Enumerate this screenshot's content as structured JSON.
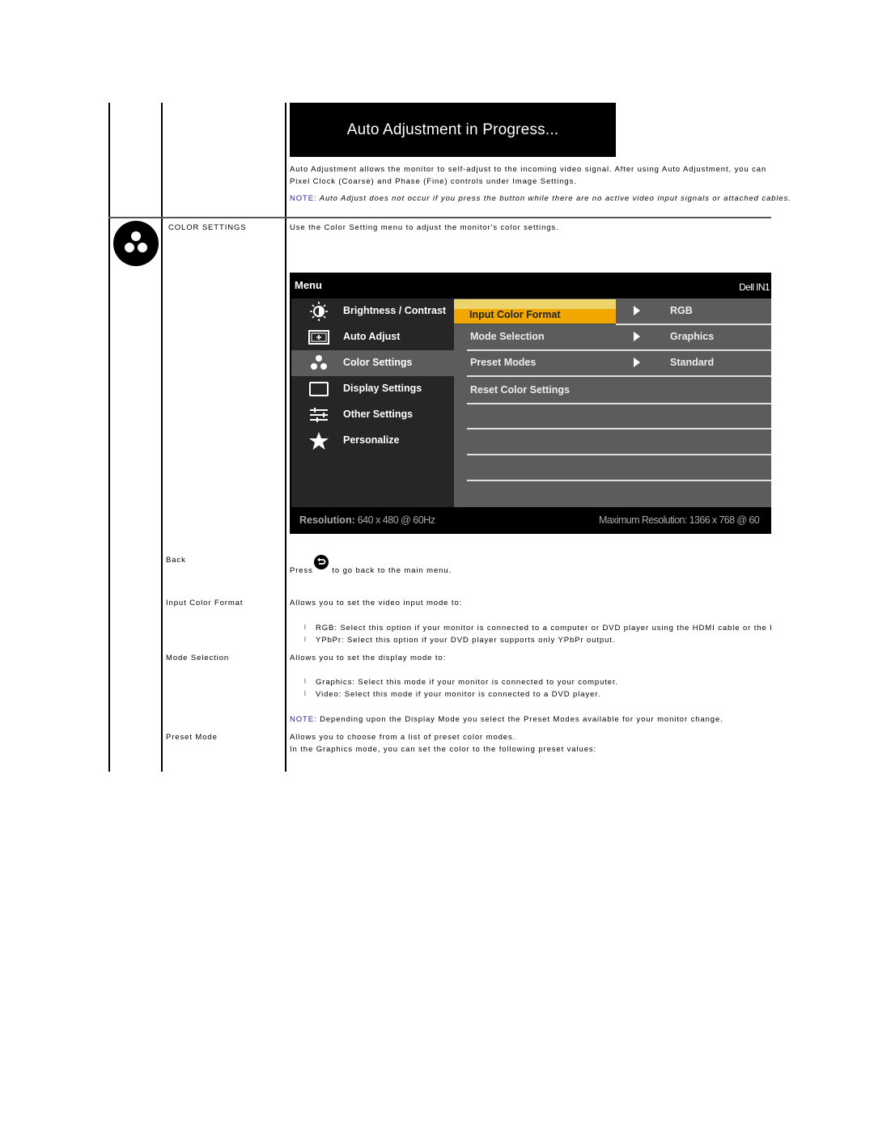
{
  "auto_adjust": {
    "banner_title": "Auto Adjustment in Progress...",
    "description_line1": "Auto Adjustment allows the monitor to self-adjust to the incoming video signal. After using Auto Adjustment, you can",
    "description_line2": "Pixel Clock (Coarse) and Phase (Fine) controls under Image Settings.",
    "note_label": "NOTE:",
    "note_text": " Auto Adjust does not occur if you press the button while there are no active video input signals or attached cables."
  },
  "color_settings": {
    "icon": "color-settings-icon",
    "label": "COLOR SETTINGS",
    "description": "Use the Color Setting menu to adjust the monitor's color settings."
  },
  "osd": {
    "menu_title": "Menu",
    "brand": "Dell IN1",
    "main_items": [
      {
        "icon": "brightness-contrast-icon",
        "label": "Brightness / Contrast",
        "active": false
      },
      {
        "icon": "auto-adjust-icon",
        "label": "Auto Adjust",
        "active": false
      },
      {
        "icon": "color-settings-icon",
        "label": "Color Settings",
        "active": true
      },
      {
        "icon": "display-settings-icon",
        "label": "Display Settings",
        "active": false
      },
      {
        "icon": "other-settings-icon",
        "label": "Other Settings",
        "active": false
      },
      {
        "icon": "personalize-icon",
        "label": "Personalize",
        "active": false
      }
    ],
    "sub_items": [
      {
        "label": "Input Color Format",
        "value": "RGB",
        "selected": true
      },
      {
        "label": "Mode Selection",
        "value": "Graphics",
        "selected": false
      },
      {
        "label": "Preset Modes",
        "value": "Standard",
        "selected": false
      },
      {
        "label": "Reset Color Settings",
        "value": "",
        "selected": false
      }
    ],
    "resolution_label": "Resolution:",
    "resolution_value": "640 x 480 @ 60Hz",
    "max_resolution": "Maximum Resolution: 1366 x 768 @ 60",
    "colors": {
      "highlight": "#f0a800",
      "highlight_top": "#ecd46a",
      "panel": "#5c5c5c",
      "menu": "#262626"
    }
  },
  "rows": {
    "back": {
      "label": "Back",
      "text_before": "Press",
      "icon": "back-button-icon",
      "text_after": " to go back to the main menu."
    },
    "input_color_format": {
      "label": "Input Color Format",
      "intro": "Allows you to set the video input mode to:",
      "bullets": [
        "RGB: Select this option if your monitor is connected to a computer or DVD player using the HDMI cable or the H",
        "YPbPr: Select this option if your DVD player supports only YPbPr output."
      ]
    },
    "mode_selection": {
      "label": "Mode Selection",
      "intro": "Allows you to set the display mode to:",
      "bullets": [
        "Graphics: Select this mode if your monitor is connected to your computer.",
        "Video: Select this mode if your monitor is connected to a DVD player."
      ],
      "note_label": "NOTE:",
      "note_text": " Depending upon the Display Mode you select the Preset Modes available for your monitor change."
    },
    "preset_mode": {
      "label": "Preset Mode",
      "line1": "Allows you to choose from a list of preset color modes.",
      "line2": "In the Graphics mode, you can set the color to the following preset values:"
    },
    "bullet_glyph": "l"
  }
}
